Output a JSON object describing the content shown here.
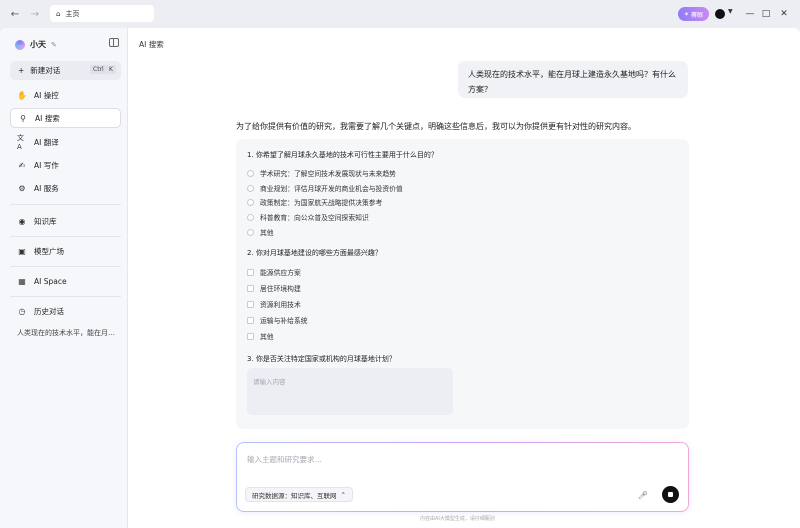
{
  "titlebar": {
    "address": "主页",
    "vip_label": "賽眼"
  },
  "sidebar": {
    "brand": "小天",
    "new_chat": {
      "label": "新建对话",
      "shortcut_1": "Ctrl",
      "shortcut_2": "K"
    },
    "items": [
      {
        "label": "AI 操控",
        "icon": "palm-icon"
      },
      {
        "label": "AI 搜索",
        "icon": "search-sparkle-icon"
      },
      {
        "label": "AI 翻译",
        "icon": "translate-icon"
      },
      {
        "label": "AI 写作",
        "icon": "pen-icon"
      },
      {
        "label": "AI 服务",
        "icon": "service-icon"
      },
      {
        "label": "知识库",
        "icon": "knowledge-icon"
      },
      {
        "label": "模型广场",
        "icon": "cube-icon"
      },
      {
        "label": "AI Space",
        "icon": "grid-icon"
      },
      {
        "label": "历史对话",
        "icon": "clock-icon"
      }
    ],
    "history": [
      "人类现在的技术水平，能在月…"
    ]
  },
  "main": {
    "page_title": "AI 搜索",
    "user_message": "人类现在的技术水平，能在月球上建造永久基地吗？有什么方案？",
    "answer_intro": "为了给你提供有价值的研究，我需要了解几个关键点，明确这些信息后，我可以为你提供更有针对性的研究内容。",
    "questions": [
      {
        "title": "1. 你希望了解月球永久基地的技术可行性主要用于什么目的？",
        "type": "radio",
        "options": [
          "学术研究：了解空间技术发展现状与未来趋势",
          "商业规划：评估月球开发的商业机会与投资价值",
          "政策制定：为国家航天战略提供决策参考",
          "科普教育：向公众普及空间探索知识",
          "其他"
        ]
      },
      {
        "title": "2. 你对月球基地建设的哪些方面最感兴趣？",
        "type": "checkbox",
        "options": [
          "能源供应方案",
          "居住环境构建",
          "资源利用技术",
          "运输与补给系统",
          "其他"
        ]
      },
      {
        "title": "3. 你是否关注特定国家或机构的月球基地计划？",
        "type": "text",
        "placeholder": "请输入内容"
      }
    ],
    "composer": {
      "placeholder": "输入主题和研究要求…",
      "source_label": "研究数据源：知识库、互联网"
    },
    "footer_note": "内容由AI大模型生成，请仔细甄别"
  }
}
